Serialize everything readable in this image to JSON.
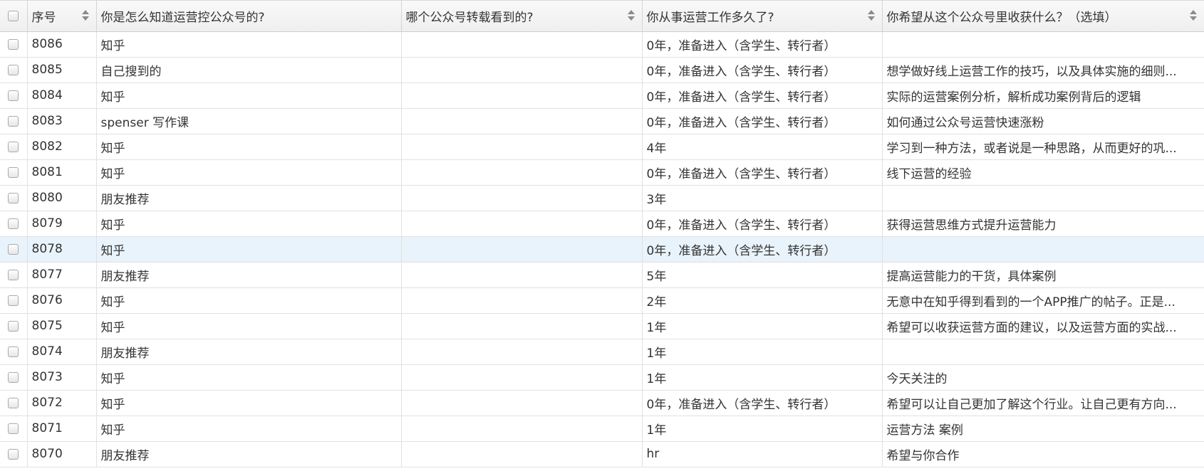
{
  "table": {
    "columns": [
      {
        "label": "序号",
        "sortable": true
      },
      {
        "label": "你是怎么知道运营控公众号的?",
        "sortable": false
      },
      {
        "label": "哪个公众号转载看到的?",
        "sortable": true
      },
      {
        "label": "你从事运营工作多久了?",
        "sortable": true
      },
      {
        "label": "你希望从这个公众号里收获什么？（选填）",
        "sortable": true
      }
    ],
    "rows": [
      {
        "id": "8086",
        "source": "知乎",
        "repost": "",
        "experience": "0年，准备进入（含学生、转行者）",
        "expectation": ""
      },
      {
        "id": "8085",
        "source": "自己搜到的",
        "repost": "",
        "experience": "0年，准备进入（含学生、转行者）",
        "expectation": "想学做好线上运营工作的技巧，以及具体实施的细则..."
      },
      {
        "id": "8084",
        "source": "知乎",
        "repost": "",
        "experience": "0年，准备进入（含学生、转行者）",
        "expectation": "实际的运营案例分析，解析成功案例背后的逻辑"
      },
      {
        "id": "8083",
        "source": "spenser 写作课",
        "repost": "",
        "experience": "0年，准备进入（含学生、转行者）",
        "expectation": "如何通过公众号运营快速涨粉"
      },
      {
        "id": "8082",
        "source": "知乎",
        "repost": "",
        "experience": "4年",
        "expectation": "学习到一种方法，或者说是一种思路，从而更好的巩..."
      },
      {
        "id": "8081",
        "source": "知乎",
        "repost": "",
        "experience": "0年，准备进入（含学生、转行者）",
        "expectation": "线下运营的经验"
      },
      {
        "id": "8080",
        "source": "朋友推荐",
        "repost": "",
        "experience": "3年",
        "expectation": ""
      },
      {
        "id": "8079",
        "source": "知乎",
        "repost": "",
        "experience": "0年，准备进入（含学生、转行者）",
        "expectation": "获得运营思维方式提升运营能力"
      },
      {
        "id": "8078",
        "source": "知乎",
        "repost": "",
        "experience": "0年，准备进入（含学生、转行者）",
        "expectation": ""
      },
      {
        "id": "8077",
        "source": "朋友推荐",
        "repost": "",
        "experience": "5年",
        "expectation": "提高运营能力的干货，具体案例"
      },
      {
        "id": "8076",
        "source": "知乎",
        "repost": "",
        "experience": "2年",
        "expectation": "无意中在知乎得到看到的一个APP推广的帖子。正是..."
      },
      {
        "id": "8075",
        "source": "知乎",
        "repost": "",
        "experience": "1年",
        "expectation": "希望可以收获运营方面的建议，以及运营方面的实战..."
      },
      {
        "id": "8074",
        "source": "朋友推荐",
        "repost": "",
        "experience": "1年",
        "expectation": ""
      },
      {
        "id": "8073",
        "source": "知乎",
        "repost": "",
        "experience": "1年",
        "expectation": "今天关注的"
      },
      {
        "id": "8072",
        "source": "知乎",
        "repost": "",
        "experience": "0年，准备进入（含学生、转行者）",
        "expectation": "希望可以让自己更加了解这个行业。让自己更有方向..."
      },
      {
        "id": "8071",
        "source": "知乎",
        "repost": "",
        "experience": "1年",
        "expectation": "运营方法 案例"
      },
      {
        "id": "8070",
        "source": "朋友推荐",
        "repost": "",
        "experience": "hr",
        "expectation": "希望与你合作"
      }
    ],
    "highlighted_row_id": "8078"
  }
}
